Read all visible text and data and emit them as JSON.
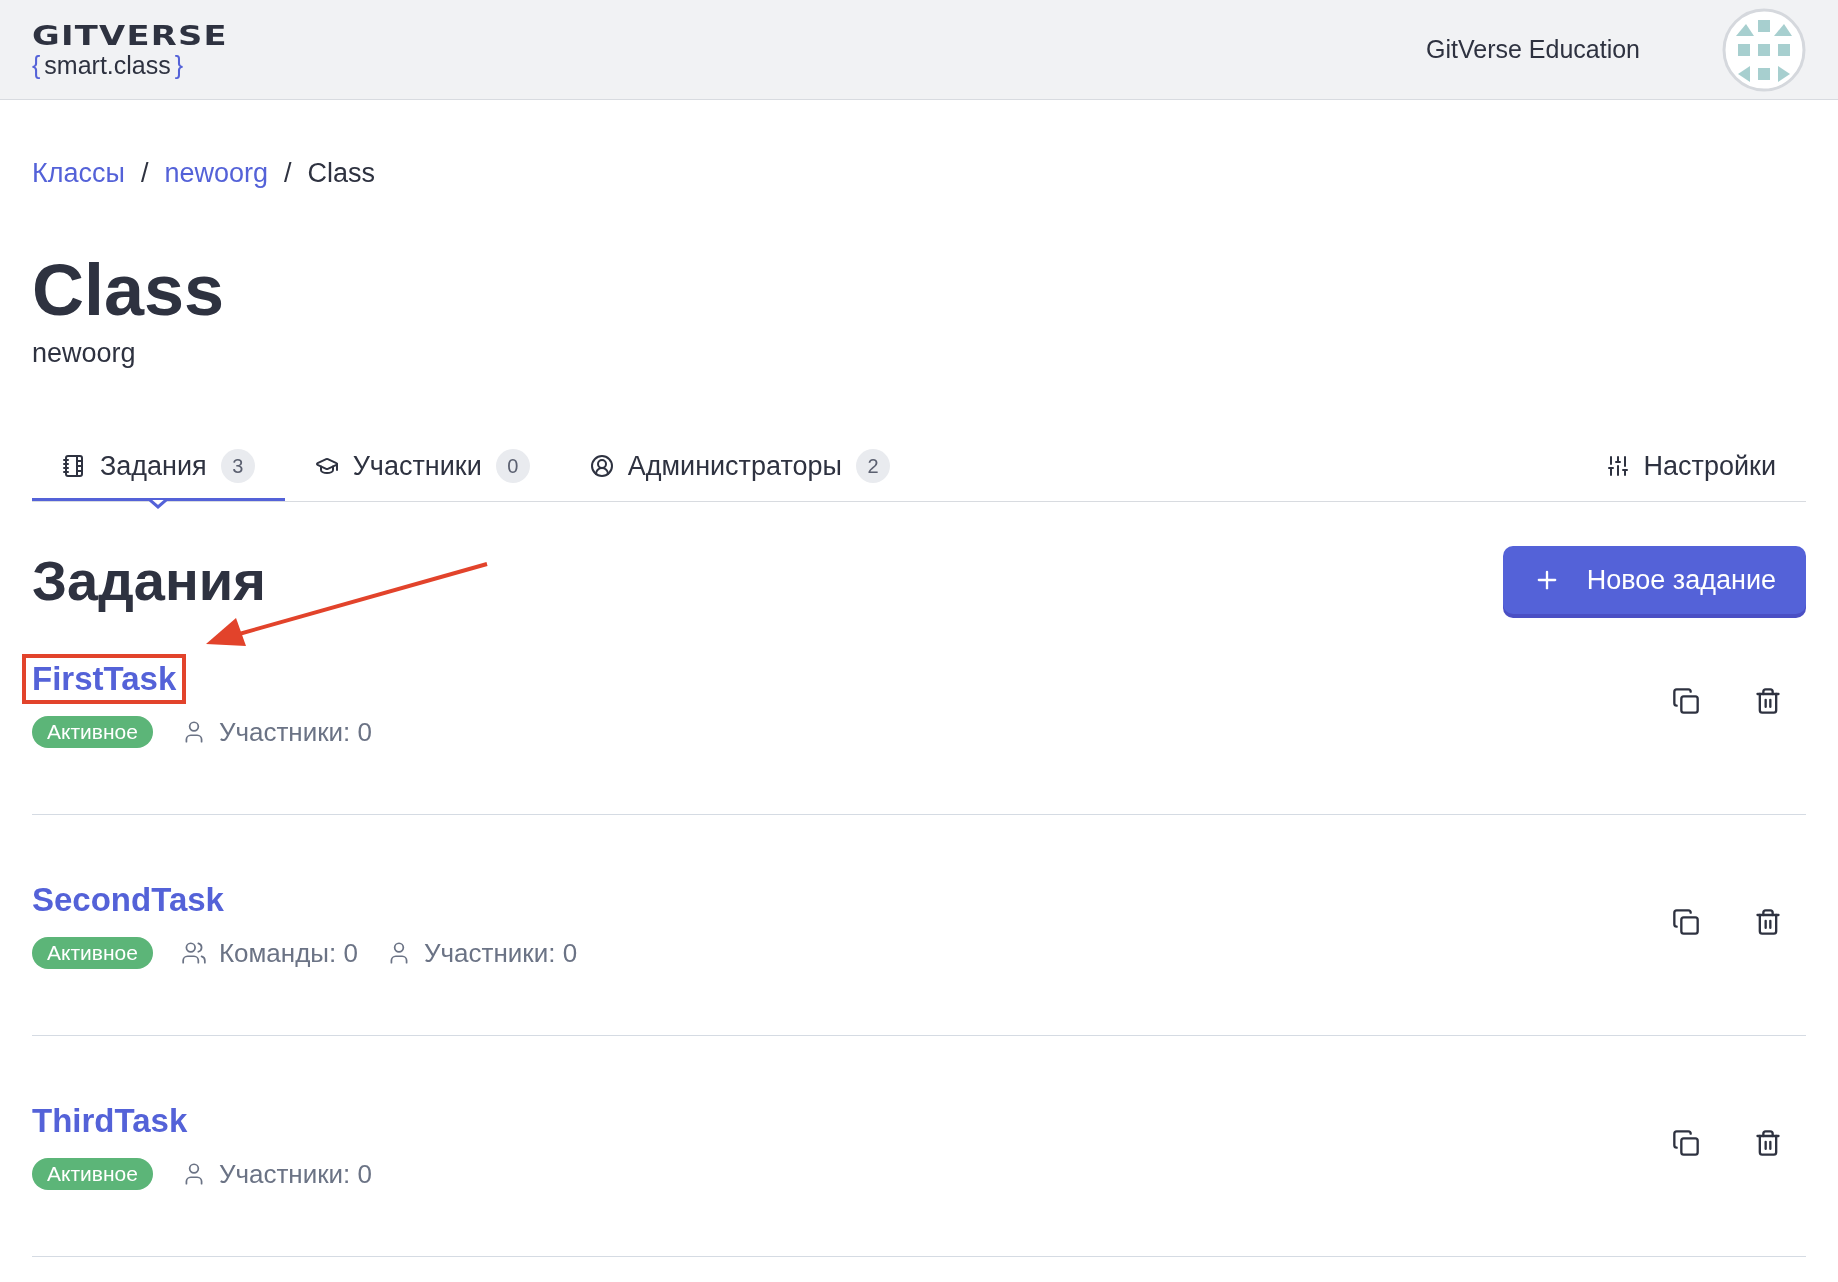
{
  "header": {
    "logo": {
      "wordmark": "GITVERSE",
      "open_brace": "{",
      "subtitle": "smart.class",
      "close_brace": "}"
    },
    "org_name": "GitVerse Education"
  },
  "breadcrumbs": [
    {
      "label": "Классы",
      "link": true
    },
    {
      "label": "newoorg",
      "link": true
    },
    {
      "label": "Class",
      "link": false
    }
  ],
  "breadcrumb_separator": "/",
  "page": {
    "title": "Class",
    "subtitle": "newoorg"
  },
  "tabs": [
    {
      "kind": "tasks",
      "label": "Задания",
      "count": "3",
      "selected": true
    },
    {
      "kind": "students",
      "label": "Участники",
      "count": "0",
      "selected": false
    },
    {
      "kind": "admins",
      "label": "Администраторы",
      "count": "2",
      "selected": false
    }
  ],
  "settings_tab": {
    "label": "Настройки"
  },
  "section": {
    "title": "Задания",
    "new_button": "Новое задание"
  },
  "tasks": [
    {
      "title": "FirstTask",
      "highlighted": true,
      "status": {
        "label": "Активное",
        "kind": "active"
      },
      "meta": [
        {
          "kind": "members",
          "label": "Участники: 0"
        }
      ]
    },
    {
      "title": "SecondTask",
      "highlighted": false,
      "status": {
        "label": "Активное",
        "kind": "active"
      },
      "meta": [
        {
          "kind": "teams",
          "label": "Команды: 0"
        },
        {
          "kind": "members",
          "label": "Участники: 0"
        }
      ]
    },
    {
      "title": "ThirdTask",
      "highlighted": false,
      "status": {
        "label": "Активное",
        "kind": "active"
      },
      "meta": [
        {
          "kind": "members",
          "label": "Участники: 0"
        }
      ]
    }
  ]
}
